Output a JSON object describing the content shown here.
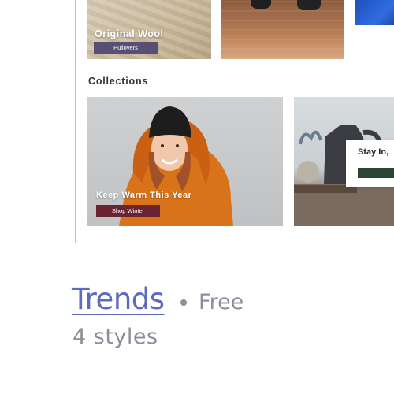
{
  "preview": {
    "top_cards": [
      {
        "title": "Original Wool",
        "cta": "Pullovers"
      },
      {
        "title": "",
        "cta": ""
      },
      {
        "title": "",
        "cta": ""
      }
    ],
    "collections_label": "Collections",
    "collections": [
      {
        "title": "Keep Warm This Year",
        "cta": "Shop Winter"
      },
      {
        "title": "",
        "cta": ""
      }
    ],
    "popup": {
      "title": "Stay In,"
    }
  },
  "theme_card": {
    "name": "Trends",
    "price": "Free",
    "styles_count": "4 styles"
  },
  "colors": {
    "accent": "#5c6bc0",
    "muted_text": "#8b8f99",
    "pullovers_button": "#575074",
    "shop_winter_button": "#6b2332",
    "popup_button": "#2b4535"
  }
}
